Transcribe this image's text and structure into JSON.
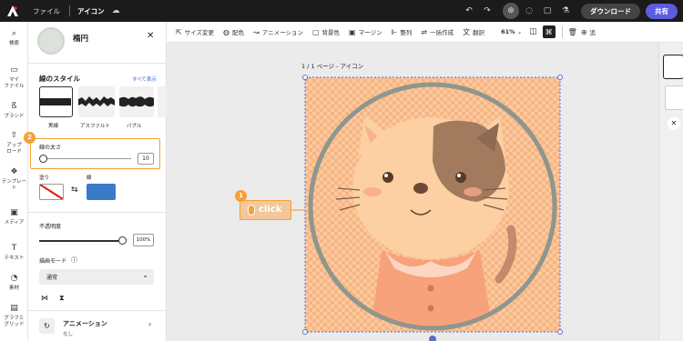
{
  "topbar": {
    "menu_file": "ファイル",
    "doc_name": "アイコン",
    "download_label": "ダウンロード",
    "share_label": "共有"
  },
  "leftrail": [
    {
      "icon": "search-icon",
      "glyph": "⌕",
      "label": "検索"
    },
    {
      "icon": "folder-icon",
      "glyph": "▭",
      "label": "マイ\nファイル"
    },
    {
      "icon": "brand-icon",
      "glyph": "ß",
      "label": "ブランド"
    },
    {
      "icon": "upload-icon",
      "glyph": "⇧",
      "label": "アップ\nロード"
    },
    {
      "icon": "template-icon",
      "glyph": "❖",
      "label": "テンプレー\nト"
    },
    {
      "icon": "media-icon",
      "glyph": "▣",
      "label": "メディア"
    },
    {
      "icon": "text-icon",
      "glyph": "T",
      "label": "テキスト"
    },
    {
      "icon": "elements-icon",
      "glyph": "◔",
      "label": "素材"
    },
    {
      "icon": "chart-icon",
      "glyph": "▤",
      "label": "グラフと\nグリッド"
    }
  ],
  "panel": {
    "title": "楕円",
    "stroke_style_heading": "線のスタイル",
    "show_all": "すべて表示",
    "styles": [
      "実線",
      "アスファルト",
      "バブル"
    ],
    "stroke_width_label": "線の太さ",
    "stroke_width_value": "10",
    "stroke_width_fraction": 0.0,
    "fill_label": "塗り",
    "stroke_label": "線",
    "stroke_color": "#3a7bc8",
    "opacity_label": "不透明度",
    "opacity_value": "100%",
    "opacity_fraction": 1.0,
    "blend_label": "描画モード",
    "blend_value": "通常",
    "animation_label": "アニメーション",
    "animation_value": "なし"
  },
  "toolbar": {
    "items": [
      "サイズ変更",
      "配色",
      "アニメーション",
      "背景色",
      "マージン",
      "整列",
      "一括作成",
      "翻訳"
    ],
    "zoom": "61%"
  },
  "canvas": {
    "page_label": "1 / 1 ページ - アイコン",
    "click_label": "click",
    "step1": "1",
    "step2": "2"
  },
  "rightbar": {
    "add_label": "追"
  },
  "colors": {
    "accent_orange": "#f5a035",
    "share_purple": "#5c5ce0",
    "ring": "#8e968d"
  }
}
